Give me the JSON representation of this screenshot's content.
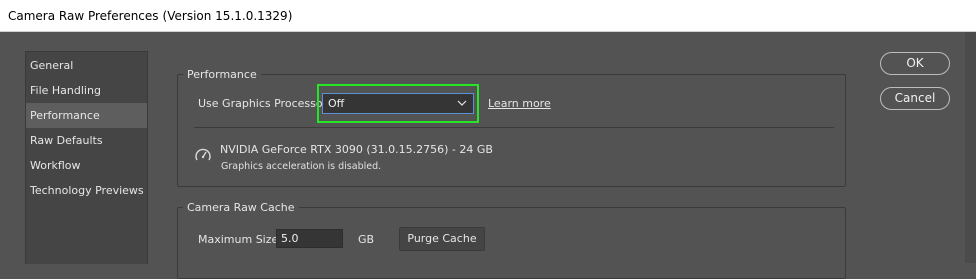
{
  "window": {
    "title": "Camera Raw Preferences",
    "version": "(Version 15.1.0.1329)"
  },
  "sidebar": {
    "items": [
      {
        "label": "General"
      },
      {
        "label": "File Handling"
      },
      {
        "label": "Performance",
        "selected": true
      },
      {
        "label": "Raw Defaults"
      },
      {
        "label": "Workflow"
      },
      {
        "label": "Technology Previews"
      }
    ]
  },
  "performance": {
    "title": "Performance",
    "gpu_label": "Use Graphics Processor:",
    "gpu_value": "Off",
    "learn_more": "Learn more",
    "gpu_name": "NVIDIA GeForce RTX 3090 (31.0.15.2756) - 24 GB",
    "gpu_status": "Graphics acceleration is disabled.",
    "icon": "speedometer-icon"
  },
  "cache": {
    "title": "Camera Raw Cache",
    "max_size_label": "Maximum Size:",
    "max_size_value": "5.0",
    "unit": "GB",
    "purge_label": "Purge Cache"
  },
  "buttons": {
    "ok": "OK",
    "cancel": "Cancel"
  },
  "colors": {
    "highlight": "#25e625",
    "background": "#535353",
    "focus": "#5b8fd6"
  }
}
